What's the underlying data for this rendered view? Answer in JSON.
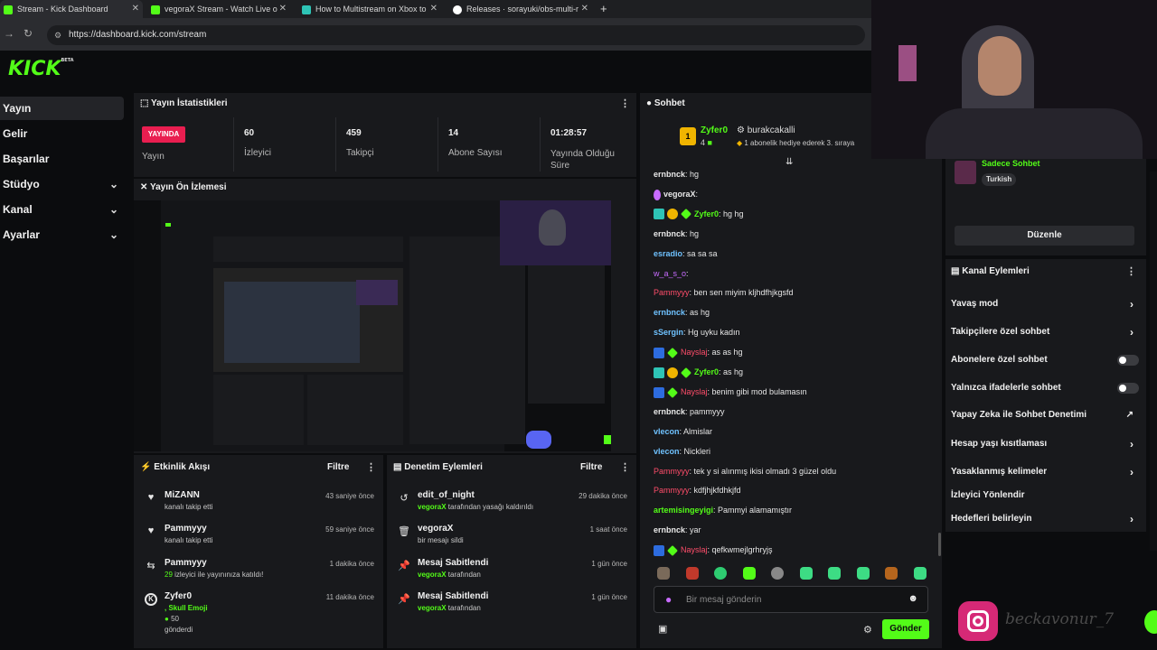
{
  "browser": {
    "tabs": [
      {
        "label": "Stream - Kick Dashboard",
        "icon": "kick-favicon",
        "color": "#53fc18"
      },
      {
        "label": "vegoraX Stream - Watch Live o",
        "icon": "kick-favicon",
        "color": "#53fc18"
      },
      {
        "label": "How to Multistream on Xbox to",
        "icon": "restream-favicon",
        "color": "#2ec4b6"
      },
      {
        "label": "Releases · sorayuki/obs-multi-r",
        "icon": "github-favicon",
        "color": "#ffffff"
      }
    ],
    "url": "https://dashboard.kick.com/stream"
  },
  "sidebar": {
    "logo": "KICK",
    "logo_sup": "BETA",
    "items": [
      {
        "label": "Yayın",
        "active": true
      },
      {
        "label": "Gelir"
      },
      {
        "label": "Başarılar"
      },
      {
        "label": "Stüdyo",
        "chevron": true
      },
      {
        "label": "Kanal",
        "chevron": true
      },
      {
        "label": "Ayarlar",
        "chevron": true
      }
    ]
  },
  "stats": {
    "title": "Yayın İstatistikleri",
    "live_badge": "YAYINDA",
    "live_label": "Yayın",
    "items": [
      {
        "value": "60",
        "label": "İzleyici"
      },
      {
        "value": "459",
        "label": "Takipçi"
      },
      {
        "value": "14",
        "label": "Abone Sayısı"
      },
      {
        "value": "01:28:57",
        "label": "Yayında Olduğu Süre"
      }
    ]
  },
  "preview": {
    "title": "Yayın Ön İzlemesi"
  },
  "activity": {
    "title": "Etkinlik Akışı",
    "filter": "Filtre",
    "items": [
      {
        "icon": "heart-icon",
        "name": "MiZANN",
        "sub": "kanalı takip etti",
        "time": "43 saniye önce"
      },
      {
        "icon": "heart-icon",
        "name": "Pammyyy",
        "sub": "kanalı takip etti",
        "time": "59 saniye önce"
      },
      {
        "icon": "raid-icon",
        "name": "Pammyyy",
        "sub_green": "29",
        "sub": " izleyici ile yayınınıza katıldı!",
        "time": "1 dakika önce"
      },
      {
        "icon": "kick-icon",
        "name": "Zyfer0",
        "sub_green": ", Skull Emoji",
        "sub2": "50",
        "sub3": "gönderdi",
        "time": "11 dakika önce"
      }
    ]
  },
  "moderation": {
    "title": "Denetim Eylemleri",
    "filter": "Filtre",
    "items": [
      {
        "icon": "undo-icon",
        "name": "edit_of_night",
        "sub_green": "vegoraX",
        "sub": " tarafından yasağı kaldırıldı",
        "time": "29 dakika önce"
      },
      {
        "icon": "trash-icon",
        "name": "vegoraX",
        "sub": "bir mesajı sildi",
        "time": "1 saat önce"
      },
      {
        "icon": "pin-icon",
        "name": "Mesaj Sabitlendi",
        "sub_green": "vegoraX",
        "sub": " tarafından",
        "time": "1 gün önce"
      },
      {
        "icon": "pin-icon",
        "name": "Mesaj Sabitlendi",
        "sub_green": "vegoraX",
        "sub": " tarafından",
        "time": "1 gün önce"
      }
    ]
  },
  "chat": {
    "title": "Sohbet",
    "pinned": {
      "user1": "Zyfer0",
      "count": "4",
      "user2": "burakcakalli",
      "text": "1 abonelik hediye ederek 3. sıraya"
    },
    "messages": [
      {
        "user": "ernbnck",
        "cls": "u-white",
        "text": ": hg"
      },
      {
        "user": "vegoraX",
        "cls": "u-white",
        "text": ":",
        "badge": "mic"
      },
      {
        "user": "Zyfer0",
        "cls": "u-green",
        "text": ": hg hg",
        "badge": "multi"
      },
      {
        "user": "ernbnck",
        "cls": "u-white",
        "text": ": hg"
      },
      {
        "user": "esradio",
        "cls": "u-blue",
        "text": ": sa sa sa"
      },
      {
        "user": "w_a_s_o",
        "cls": "u-purple",
        "text": ":"
      },
      {
        "user": "Pammyyy",
        "cls": "u-red",
        "text": ": ben sen miyim kljhdfhjkgsfd"
      },
      {
        "user": "ernbnck",
        "cls": "u-blue",
        "text": ": as hg"
      },
      {
        "user": "sSergin",
        "cls": "u-blue",
        "text": ": Hg uyku kadın"
      },
      {
        "user": "Nayslaj",
        "cls": "u-red",
        "text": ": as as hg",
        "badge": "mod"
      },
      {
        "user": "Zyfer0",
        "cls": "u-green",
        "text": ": as hg",
        "badge": "multi"
      },
      {
        "user": "Nayslaj",
        "cls": "u-red",
        "text": ": benim gibi mod bulamasın",
        "badge": "mod"
      },
      {
        "user": "ernbnck",
        "cls": "u-white",
        "text": ": pammyyy"
      },
      {
        "user": "vlecon",
        "cls": "u-blue",
        "text": ": Almislar"
      },
      {
        "user": "vlecon",
        "cls": "u-blue",
        "text": ": Nickleri"
      },
      {
        "user": "Pammyyy",
        "cls": "u-red",
        "text": ": tek y si alınmış ikisi olmadı 3 güzel oldu"
      },
      {
        "user": "Pammyyy",
        "cls": "u-red",
        "text": ": kdfjhjkfdhkjfd"
      },
      {
        "user": "artemisingeyigi",
        "cls": "u-green",
        "text": ": Pammyi alamamıştır"
      },
      {
        "user": "ernbnck",
        "cls": "u-white",
        "text": ": yar"
      },
      {
        "user": "Nayslaj",
        "cls": "u-red",
        "text": ": qefkwmejlgrhryjş",
        "badge": "mod"
      }
    ],
    "input_placeholder": "Bir mesaj gönderin",
    "send_label": "Gönder"
  },
  "channel": {
    "chat_mode": "Sadece Sohbet",
    "language": "Turkish",
    "edit_label": "Düzenle",
    "actions_title": "Kanal Eylemleri",
    "actions": [
      {
        "label": "Yavaş mod",
        "kind": "arrow"
      },
      {
        "label": "Takipçilere özel sohbet",
        "kind": "arrow"
      },
      {
        "label": "Abonelere özel sohbet",
        "kind": "toggle"
      },
      {
        "label": "Yalnızca ifadelerle sohbet",
        "kind": "toggle"
      },
      {
        "label": "Yapay Zeka ile Sohbet Denetimi",
        "kind": "external"
      },
      {
        "label": "Hesap yaşı kısıtlaması",
        "kind": "arrow"
      },
      {
        "label": "Yasaklanmış kelimeler",
        "kind": "arrow"
      },
      {
        "label": "İzleyici Yönlendir",
        "kind": "none"
      },
      {
        "label": "Hedefleri belirleyin",
        "kind": "arrow"
      }
    ]
  },
  "overlay": {
    "handle": "beckavonur_7"
  },
  "colors": {
    "accent": "#53fc18",
    "live": "#e91e50",
    "panel": "#18191c"
  }
}
